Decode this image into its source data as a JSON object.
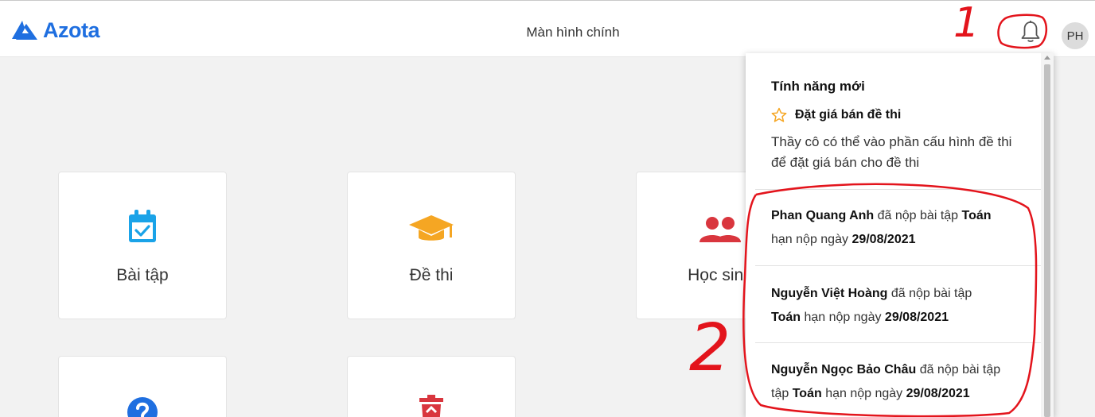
{
  "app": {
    "logo_text": "Azota",
    "title": "Màn hình chính",
    "avatar_initials": "PH",
    "brand_color": "#1f6fe0"
  },
  "tiles": [
    {
      "label": "Bài tập",
      "icon": "calendar-check-icon",
      "color": "#1aa3e8"
    },
    {
      "label": "Đề thi",
      "icon": "graduation-cap-icon",
      "color": "#f5a623"
    },
    {
      "label": "Học sinh",
      "icon": "users-icon",
      "color": "#d9363e"
    },
    {
      "label": "",
      "icon": "question-circle-icon",
      "color": "#1f6fe0"
    },
    {
      "label": "",
      "icon": "trash-icon",
      "color": "#d9363e"
    }
  ],
  "notifications": {
    "section_title": "Tính năng mới",
    "feature": {
      "icon": "star-outline-icon",
      "title": "Đặt giá bán đề thi",
      "description": "Thầy cô có thể vào phần cấu hình đề thi để đặt giá bán cho đề thi"
    },
    "items": [
      {
        "name": "Phan Quang Anh",
        "action": "đã nộp bài tập",
        "subject": "Toán",
        "deadline_label": "hạn nộp ngày",
        "deadline": "29/08/2021"
      },
      {
        "name": "Nguyễn Việt Hoàng",
        "action": "đã nộp bài tập",
        "subject": "Toán",
        "deadline_label": "hạn nộp ngày",
        "deadline": "29/08/2021"
      },
      {
        "name": "Nguyễn Ngọc Bảo Châu",
        "action": "đã nộp bài tập",
        "subject": "Toán",
        "deadline_label": "hạn nộp ngày",
        "deadline": "29/08/2021"
      }
    ]
  },
  "annotations": {
    "ink_color": "#e3141c",
    "label_1": "1",
    "label_2": "2"
  }
}
